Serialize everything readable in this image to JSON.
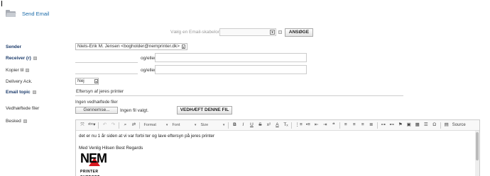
{
  "page": {
    "title": "Send Email"
  },
  "template": {
    "label": "Vælg en Email-skabelon",
    "search_label": "ANSØGE"
  },
  "form": {
    "sender_label": "Sender",
    "sender_value": "Niels-Erik M. Jensen <bogholder@nemprinter.dk>",
    "receiver_label": "Receiver (r)",
    "copy_label": "Kopier til",
    "or_label": "og/eller",
    "delivery_label": "Delivery Ack.",
    "delivery_value": "Nej",
    "topic_label": "Email topic",
    "topic_value": "Eftersyn af jeres printer",
    "attachments_label": "Vedhæftede filer",
    "no_attachments": "Ingen vedhæftede filer",
    "browse_label": "Gennemse...",
    "file_status": "Ingen fil valgt.",
    "attach_button": "VEDHÆFT DENNE FIL",
    "message_label": "Besked"
  },
  "toolbar": {
    "format": "Format",
    "font": "Font",
    "size": "Size",
    "source": "Source",
    "bold": "B",
    "italic": "I",
    "underline": "U",
    "strike": "S",
    "superscript": "x²",
    "omega": "Ω"
  },
  "editor": {
    "line1": "det er nu 1 år siden at vi var forbi ter og lave eftersyn på jeres printer",
    "line2": "Med Venlig Hilsen Best Regards",
    "logo_letters": "NEM",
    "logo_sub": "PRINTER SUPPORT"
  },
  "colors": {
    "link_blue": "#1a6aa8",
    "logo_red": "#d71920",
    "label_navy": "#1a3a6a"
  }
}
